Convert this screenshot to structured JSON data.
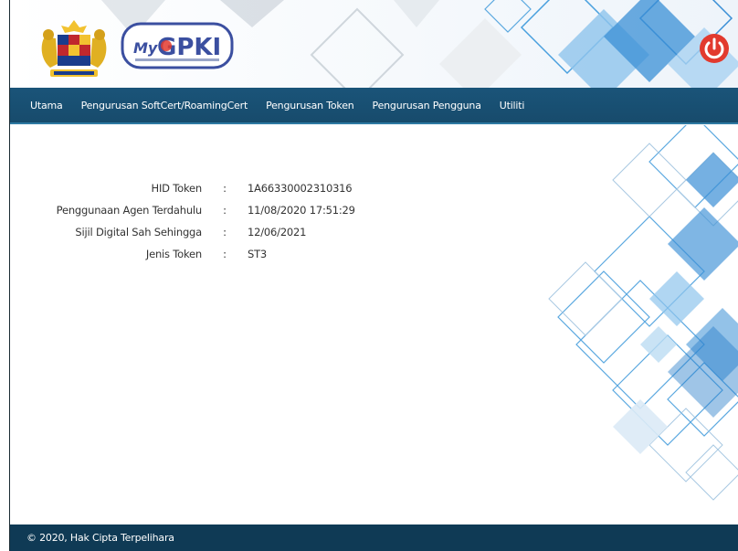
{
  "header": {
    "logo_text_my": "My",
    "logo_text_gpki": "GPKI",
    "power_icon": "power-icon"
  },
  "nav": {
    "items": [
      {
        "label": "Utama"
      },
      {
        "label": "Pengurusan SoftCert/RoamingCert"
      },
      {
        "label": "Pengurusan Token"
      },
      {
        "label": "Pengurusan Pengguna"
      },
      {
        "label": "Utiliti"
      }
    ]
  },
  "token_info": {
    "separator": ":",
    "rows": [
      {
        "label": "HID Token",
        "value": "1A66330002310316"
      },
      {
        "label": "Penggunaan Agen Terdahulu",
        "value": "11/08/2020 17:51:29"
      },
      {
        "label": "Sijil Digital Sah Sehingga",
        "value": "12/06/2021"
      },
      {
        "label": "Jenis Token",
        "value": "ST3"
      }
    ]
  },
  "footer": {
    "text": "© 2020, Hak Cipta Terpelihara"
  },
  "colors": {
    "navbar": "#174b6c",
    "footer": "#0f3a55",
    "power": "#e23a2e",
    "accent_blue": "#3a8fd6"
  }
}
